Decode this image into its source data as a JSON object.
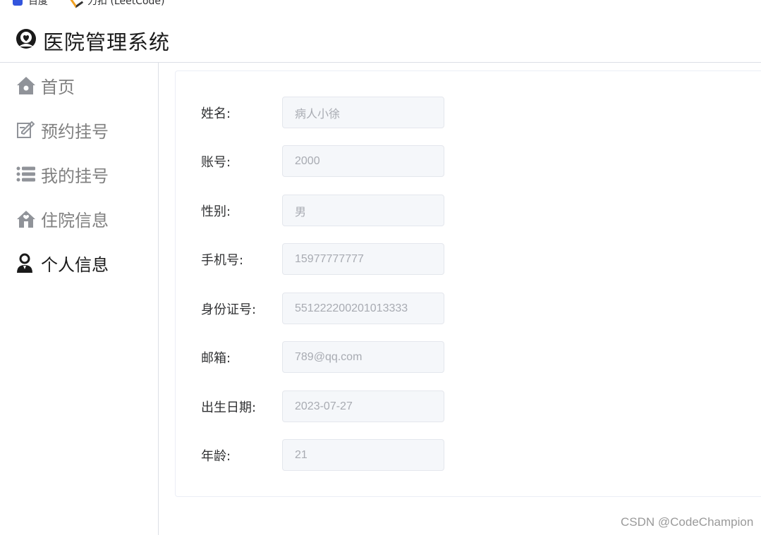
{
  "bookmarks": [
    {
      "label": "百度",
      "icon": "baidu-icon"
    },
    {
      "label": "力扣 (LeetCode)",
      "icon": "leetcode-icon"
    }
  ],
  "header": {
    "title": "医院管理系统",
    "logo_icon": "doctor-logo-icon"
  },
  "sidebar": {
    "items": [
      {
        "label": "首页",
        "icon": "home-icon",
        "active": false
      },
      {
        "label": "预约挂号",
        "icon": "edit-icon",
        "active": false
      },
      {
        "label": "我的挂号",
        "icon": "list-icon",
        "active": false
      },
      {
        "label": "住院信息",
        "icon": "house-icon",
        "active": false
      },
      {
        "label": "个人信息",
        "icon": "user-icon",
        "active": true
      }
    ]
  },
  "profile_form": {
    "fields": [
      {
        "label": "姓名:",
        "value": "病人小徐"
      },
      {
        "label": "账号:",
        "value": "2000"
      },
      {
        "label": "性别:",
        "value": "男"
      },
      {
        "label": "手机号:",
        "value": "15977777777"
      },
      {
        "label": "身份证号:",
        "value": "551222200201013333"
      },
      {
        "label": "邮箱:",
        "value": "789@qq.com"
      },
      {
        "label": "出生日期:",
        "value": "2023-07-27"
      },
      {
        "label": "年龄:",
        "value": "21"
      }
    ]
  },
  "watermark": "CSDN @CodeChampion",
  "colors": {
    "menu_inactive": "#808080",
    "menu_active": "#1a1a1a",
    "input_bg": "#f5f7fa",
    "input_text": "#a8abb2",
    "border": "#dcdfe6"
  }
}
